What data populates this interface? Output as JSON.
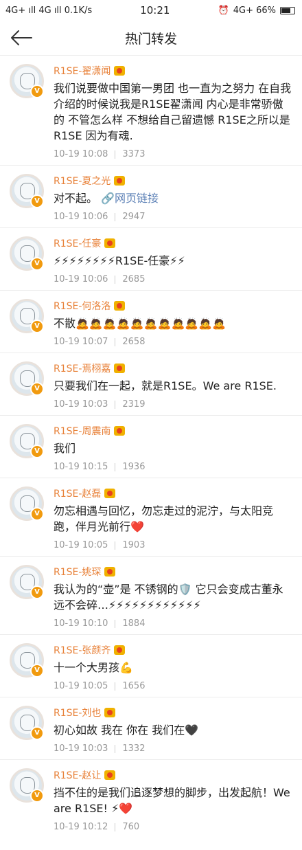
{
  "status_bar": {
    "left": "4G+ ıll  4G ıll  0.1K/s",
    "time": "10:21",
    "right": "4G+  66%"
  },
  "header": {
    "title": "热门转发"
  },
  "reposts": [
    {
      "name": "R1SE-翟潇闻",
      "text": "我们说要做中国第一男团 也一直为之努力 在自我介绍的时候说我是R1SE翟潇闻 内心是非常骄傲的 不管怎么样 不想给自己留遗憾  R1SE之所以是R1SE 因为有魂.",
      "time": "10-19 10:08",
      "count": "3373"
    },
    {
      "name": "R1SE-夏之光",
      "text": "对不起。",
      "link": "网页链接",
      "time": "10-19 10:06",
      "count": "2947"
    },
    {
      "name": "R1SE-任豪",
      "text": "⚡⚡⚡⚡⚡⚡⚡⚡R1SE-任豪⚡⚡",
      "time": "10-19 10:06",
      "count": "2685"
    },
    {
      "name": "R1SE-何洛洛",
      "text": "不散🙇🙇🙇🙇🙇🙇🙇🙇🙇🙇🙇",
      "time": "10-19 10:07",
      "count": "2658"
    },
    {
      "name": "R1SE-焉栩嘉",
      "text": "只要我们在一起，就是R1SE。We are R1SE.",
      "time": "10-19 10:03",
      "count": "2319"
    },
    {
      "name": "R1SE-周震南",
      "text": "我们",
      "time": "10-19 10:15",
      "count": "1936"
    },
    {
      "name": "R1SE-赵磊",
      "text": "勿忘相遇与回忆，勿忘走过的泥泞，与太阳竞跑，伴月光前行❤️",
      "time": "10-19 10:05",
      "count": "1903"
    },
    {
      "name": "R1SE-姚琛",
      "text": "我认为的“壶”是 不锈钢的🛡️ 它只会变成古董永远不会碎…⚡⚡⚡⚡⚡⚡⚡⚡⚡⚡⚡⚡",
      "time": "10-19 10:10",
      "count": "1884"
    },
    {
      "name": "R1SE-张颜齐",
      "text": "十一个大男孩💪",
      "time": "10-19 10:05",
      "count": "1656"
    },
    {
      "name": "R1SE-刘也",
      "text": "初心如故  我在  你在  我们在🖤",
      "time": "10-19 10:03",
      "count": "1332"
    },
    {
      "name": "R1SE-赵让",
      "text": "挡不住的是我们追逐梦想的脚步，出发起航！We are R1SE! ⚡❤️",
      "time": "10-19 10:12",
      "count": "760"
    }
  ],
  "colors": {
    "name": "#e8823a",
    "link": "#5a7fb5",
    "meta": "#999999",
    "badge": "#f19a0e"
  }
}
